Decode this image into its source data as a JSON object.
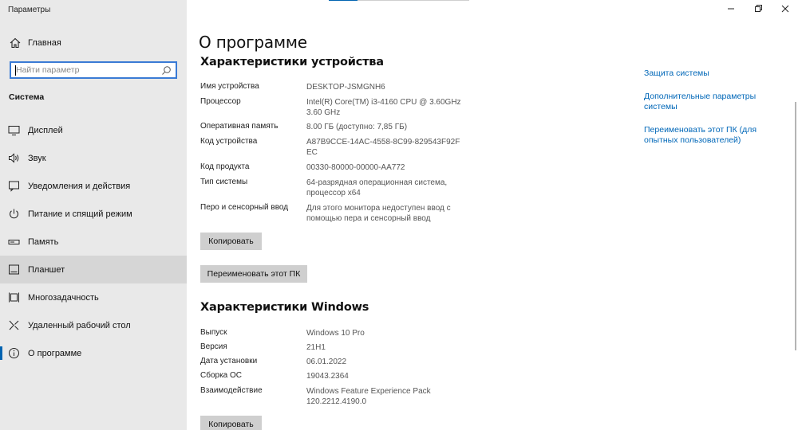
{
  "window": {
    "title": "Параметры"
  },
  "sidebar": {
    "home_label": "Главная",
    "search_placeholder": "Найти параметр",
    "section_label": "Система",
    "items": [
      {
        "label": "Дисплей",
        "icon": "display-icon"
      },
      {
        "label": "Звук",
        "icon": "sound-icon"
      },
      {
        "label": "Уведомления и действия",
        "icon": "notifications-icon"
      },
      {
        "label": "Питание и спящий режим",
        "icon": "power-icon"
      },
      {
        "label": "Память",
        "icon": "storage-icon"
      },
      {
        "label": "Планшет",
        "icon": "tablet-icon"
      },
      {
        "label": "Многозадачность",
        "icon": "multitasking-icon"
      },
      {
        "label": "Удаленный рабочий стол",
        "icon": "remote-desktop-icon"
      },
      {
        "label": "О программе",
        "icon": "info-icon"
      }
    ]
  },
  "main": {
    "title": "О программе",
    "device_section": {
      "heading": "Характеристики устройства",
      "rows": [
        {
          "label": "Имя устройства",
          "value": "DESKTOP-JSMGNH6"
        },
        {
          "label": "Процессор",
          "value": "Intel(R) Core(TM) i3-4160 CPU @ 3.60GHz 3.60 GHz"
        },
        {
          "label": "Оперативная память",
          "value": "8.00 ГБ (доступно: 7,85 ГБ)"
        },
        {
          "label": "Код устройства",
          "value": "A87B9CCE-14AC-4558-8C99-829543F92FEC"
        },
        {
          "label": "Код продукта",
          "value": "00330-80000-00000-AA772"
        },
        {
          "label": "Тип системы",
          "value": "64-разрядная операционная система, процессор x64"
        },
        {
          "label": "Перо и сенсорный ввод",
          "value": "Для этого монитора недоступен ввод с помощью пера и сенсорный ввод"
        }
      ],
      "copy_button": "Копировать",
      "rename_button": "Переименовать этот ПК"
    },
    "windows_section": {
      "heading": "Характеристики Windows",
      "rows": [
        {
          "label": "Выпуск",
          "value": "Windows 10 Pro"
        },
        {
          "label": "Версия",
          "value": "21H1"
        },
        {
          "label": "Дата установки",
          "value": "06.01.2022"
        },
        {
          "label": "Сборка ОС",
          "value": "19043.2364"
        },
        {
          "label": "Взаимодействие",
          "value": "Windows Feature Experience Pack 120.2212.4190.0"
        }
      ],
      "copy_button": "Копировать"
    },
    "related_links": [
      "Защита системы",
      "Дополнительные параметры системы",
      "Переименовать этот ПК (для опытных пользователей)"
    ]
  },
  "colors": {
    "accent": "#0063b1",
    "link": "#0067b8",
    "sidebar_bg": "#e9e9e9",
    "button_bg": "#cfcfcf"
  }
}
